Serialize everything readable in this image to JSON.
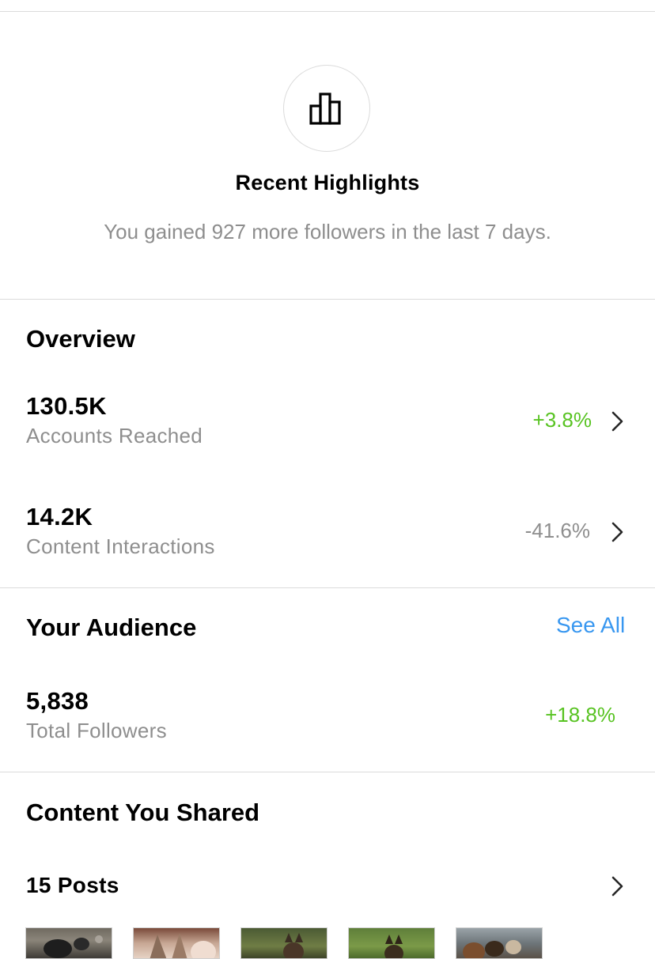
{
  "highlights": {
    "icon": "bar-chart-icon",
    "title": "Recent Highlights",
    "subtitle": "You gained 927 more followers in the last 7 days."
  },
  "overview": {
    "title": "Overview",
    "metrics": [
      {
        "value": "130.5K",
        "label": "Accounts Reached",
        "change": "+3.8%",
        "trend": "positive"
      },
      {
        "value": "14.2K",
        "label": "Content Interactions",
        "change": "-41.6%",
        "trend": "negative"
      }
    ]
  },
  "audience": {
    "title": "Your Audience",
    "see_all": "See All",
    "value": "5,838",
    "label": "Total Followers",
    "change": "+18.8%"
  },
  "content": {
    "title": "Content You Shared",
    "posts_label": "15 Posts"
  },
  "colors": {
    "positive": "#58c322",
    "neutral": "#8e8e8e",
    "link": "#3897f0",
    "divider": "#dbdbdb"
  }
}
